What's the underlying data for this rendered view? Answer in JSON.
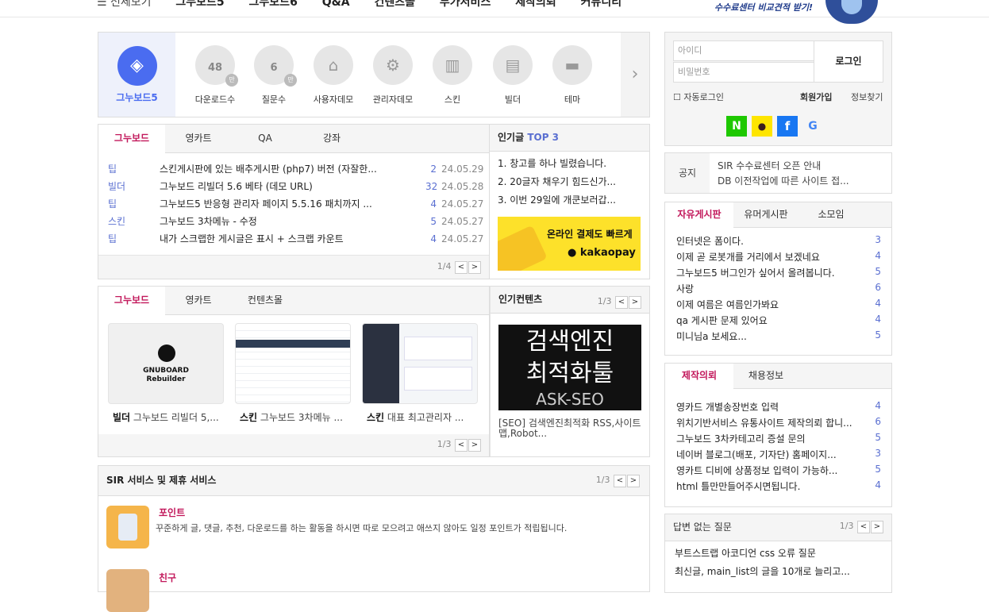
{
  "nav": {
    "all_menu": "☰ 전체보기",
    "items": [
      "그누보드5",
      "그누보드6",
      "Q&A",
      "컨텐츠몰",
      "부가서비스",
      "제작의뢰",
      "커뮤니티"
    ],
    "promo": "수수료센터 비교견적 받기!"
  },
  "quick": {
    "brand_label": "그누보드5",
    "items": [
      {
        "label": "다운로드수",
        "value": "48",
        "unit": "만"
      },
      {
        "label": "질문수",
        "value": "6",
        "unit": "만"
      },
      {
        "label": "사용자데모"
      },
      {
        "label": "관리자데모"
      },
      {
        "label": "스킨"
      },
      {
        "label": "빌더"
      },
      {
        "label": "테마"
      }
    ],
    "icons": [
      "home-icon",
      "gear-icon",
      "map-icon",
      "note-icon",
      "folder-icon"
    ]
  },
  "board1": {
    "tabs": [
      "그누보드",
      "영카트",
      "QA",
      "강좌"
    ],
    "rows": [
      {
        "cat": "팁",
        "title": "스킨게시판에 있는 배추게시판 (php7) 버전 (자잘한...",
        "count": "2",
        "date": "24.05.29"
      },
      {
        "cat": "빌더",
        "title": "그누보드 리빌더 5.6 베타 (데모 URL)",
        "count": "32",
        "date": "24.05.28"
      },
      {
        "cat": "팁",
        "title": "그누보드5 반응형 관리자 페이지 5.5.16 패치까지 ...",
        "count": "4",
        "date": "24.05.27"
      },
      {
        "cat": "스킨",
        "title": "그누보드 3차메뉴 - 수정",
        "count": "5",
        "date": "24.05.27"
      },
      {
        "cat": "팁",
        "title": "내가 스크랩한 게시글은 표시 + 스크랩 카운트",
        "count": "4",
        "date": "24.05.27"
      }
    ],
    "page": "1/4"
  },
  "popular": {
    "title": "인기글",
    "badge": "TOP 3",
    "items": [
      "1. 창고를 하나 빌렸습니다.",
      "2. 20글자 채우기 힘드신가...",
      "3. 이번 29일에 개쿤보러갑..."
    ],
    "kakao_line1": "온라인 결제도 빠르게",
    "kakao_line2": "kakaopay"
  },
  "gallery": {
    "tabs": [
      "그누보드",
      "영카트",
      "컨텐츠몰"
    ],
    "items": [
      {
        "cat": "빌더",
        "title": "그누보드 리빌더 5,..."
      },
      {
        "cat": "스킨",
        "title": "그누보드 3차메뉴 ..."
      },
      {
        "cat": "스킨",
        "title": "대표 최고관리자 ..."
      }
    ],
    "logo_line1": "GNUBOARD",
    "logo_line2": "Rebuilder",
    "page": "1/3"
  },
  "popular_contents": {
    "title": "인기컨텐츠",
    "page": "1/3",
    "image_line1": "검색엔진",
    "image_line2": "최적화툴",
    "image_line3": "ASK-SEO",
    "caption": "[SEO] 검색엔진최적화 RSS,사이트맵,Robot..."
  },
  "services": {
    "title": "SIR 서비스 및 제휴 서비스",
    "page": "1/3",
    "items": [
      {
        "name": "포인트",
        "desc": "꾸준하게 글, 댓글, 추천, 다운로드를 하는 활동을 하시면 따로 모으려고 애쓰지 않아도 일정 포인트가 적립됩니다."
      },
      {
        "name": "친구",
        "desc": ""
      }
    ]
  },
  "login": {
    "id_placeholder": "아이디",
    "pw_placeholder": "비밀번호",
    "button": "로그인",
    "auto_login": "자동로그인",
    "join": "회원가입",
    "find": "정보찾기",
    "social": [
      "N",
      "●",
      "f",
      "G"
    ]
  },
  "notice": {
    "label": "공지",
    "items": [
      "SIR 수수료센터 오픈 안내",
      "DB 이전작업에 따른 사이트 접..."
    ]
  },
  "free": {
    "tabs": [
      "자유게시판",
      "유머게시판",
      "소모임"
    ],
    "rows": [
      {
        "title": "인터넷은 폼이다.",
        "count": "3"
      },
      {
        "title": "이제 곧 로봇개를 거리에서 보겠네요",
        "count": "4"
      },
      {
        "title": "그누보드5 버그인가 싶어서 올려봅니다.",
        "count": "5"
      },
      {
        "title": "사랑",
        "count": "6"
      },
      {
        "title": "이제 여름은 여름인가봐요",
        "count": "4"
      },
      {
        "title": "qa 게시판 문제 있어요",
        "count": "4"
      },
      {
        "title": "미니님a 보세요...",
        "count": "5"
      }
    ]
  },
  "request": {
    "tabs": [
      "제작의뢰",
      "채용정보"
    ],
    "rows": [
      {
        "title": "영카드 개별송장번호 입력",
        "count": "4"
      },
      {
        "title": "위치기반서비스 유통사이트 제작의뢰 합니...",
        "count": "6"
      },
      {
        "title": "그누보드 3차카테고리 증설 문의",
        "count": "5"
      },
      {
        "title": "네이버 블로그(배포, 기자단) 홈페이지...",
        "count": "3"
      },
      {
        "title": "영카트 디비에 상품정보 입력이 가능하...",
        "count": "5"
      },
      {
        "title": "html 틀만만들어주시면됩니다.",
        "count": "4"
      }
    ]
  },
  "unanswered": {
    "title": "답변 없는 질문",
    "page": "1/3",
    "items": [
      "부트스트랩 아코디언 css 오류 질문",
      "최신글, main_list의 글을 10개로 늘리고..."
    ]
  },
  "colors": {
    "accent": "#c2185b",
    "brand": "#4a6cf0",
    "link": "#5a6fd1"
  }
}
